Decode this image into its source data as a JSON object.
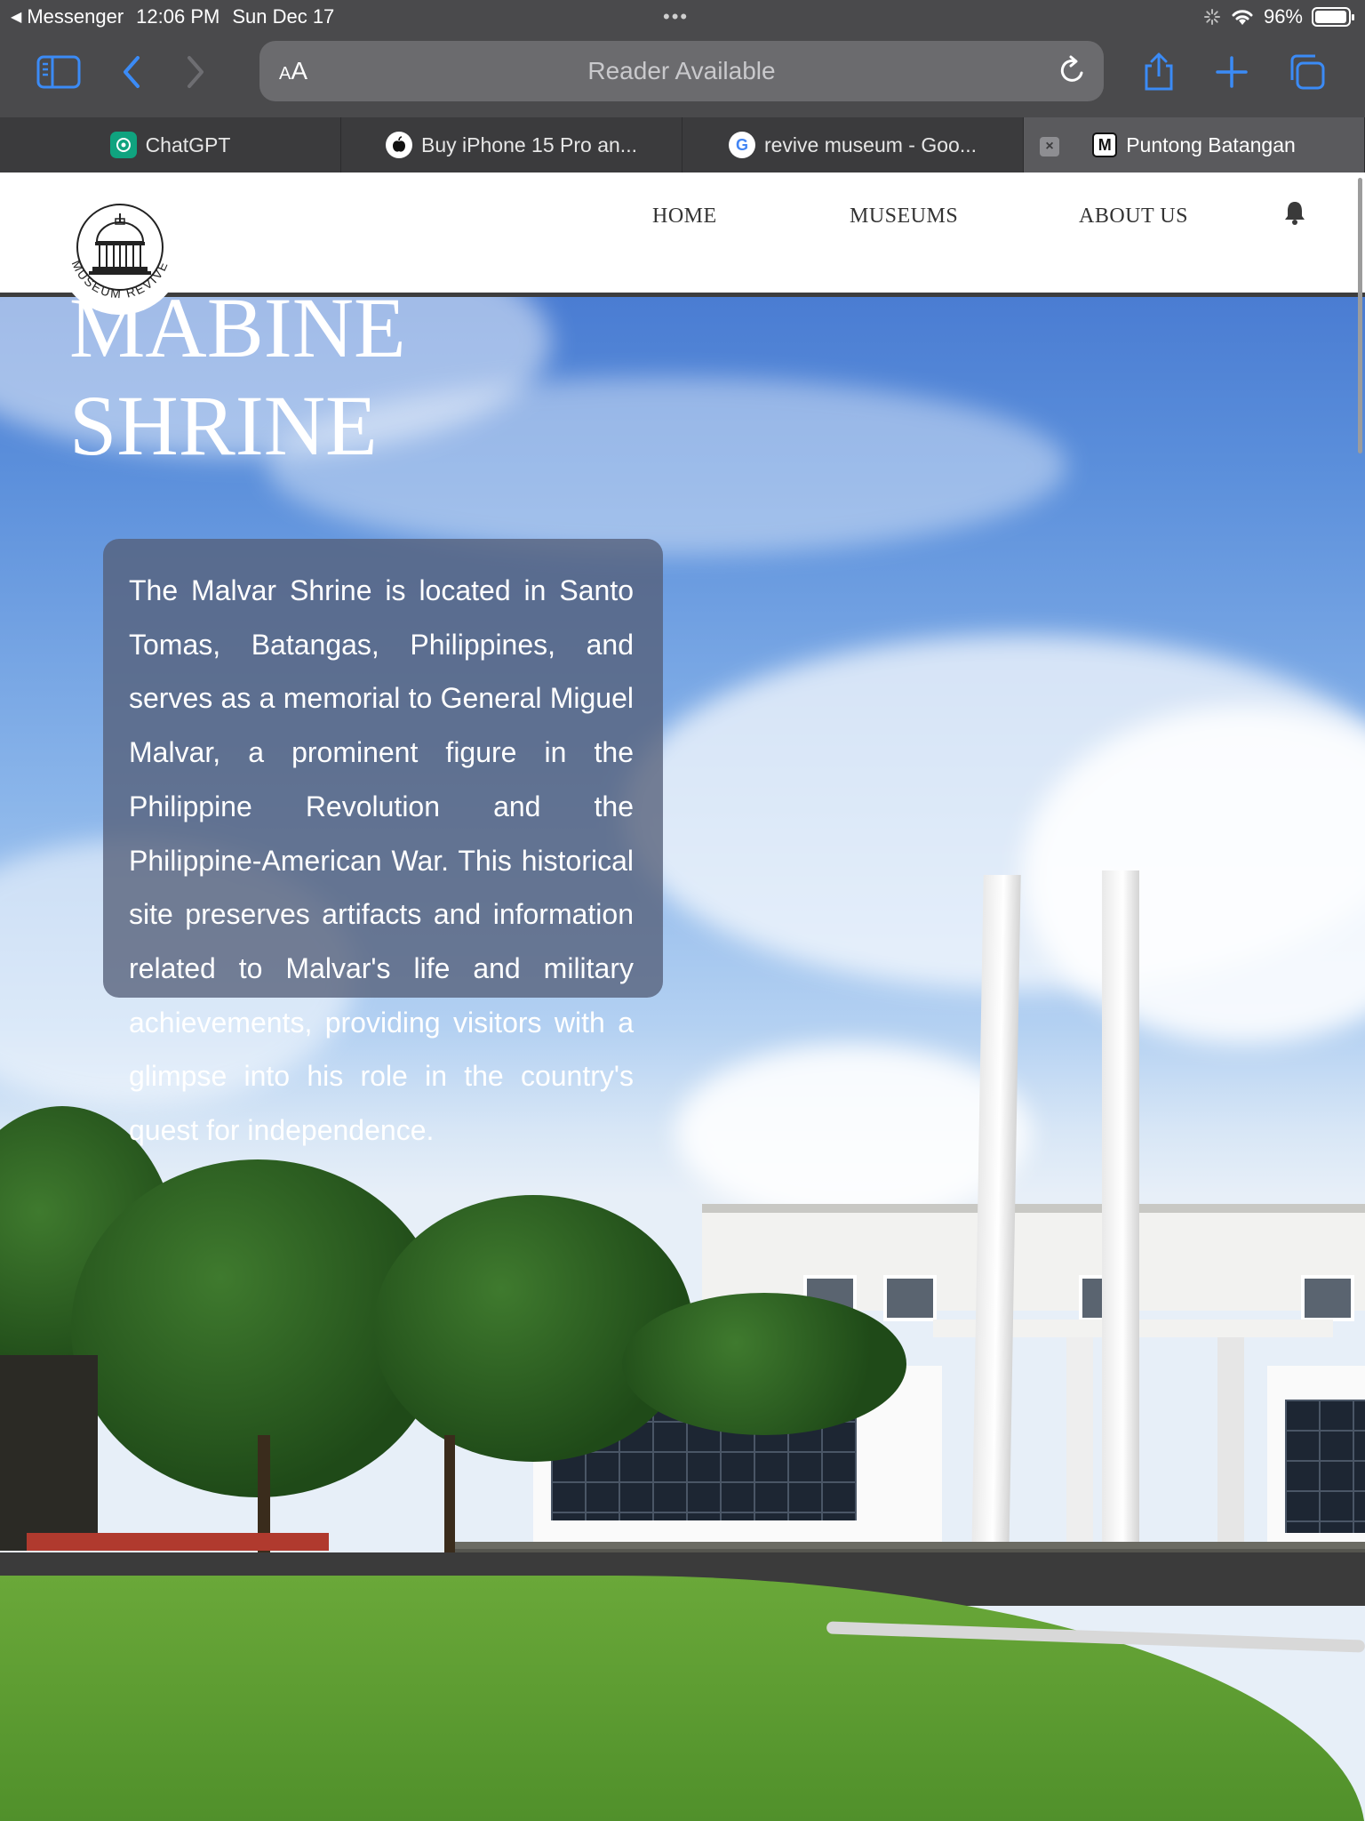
{
  "status_bar": {
    "back_app": "Messenger",
    "time": "12:06 PM",
    "date": "Sun Dec 17",
    "battery": "96%",
    "battery_level": 0.96
  },
  "toolbar": {
    "text_size_label_small": "A",
    "text_size_label_large": "A",
    "address_text": "Reader Available"
  },
  "tabs": [
    {
      "label": "ChatGPT",
      "icon": "chatgpt-icon",
      "color": "#10a37f",
      "active": false
    },
    {
      "label": "Buy iPhone 15 Pro an...",
      "icon": "apple-icon",
      "color": "#ffffff",
      "active": false
    },
    {
      "label": "revive museum - Goo...",
      "icon": "google-icon",
      "color": "#ffffff",
      "active": false
    },
    {
      "label": "Puntong Batangan",
      "icon": "m-icon",
      "favicon_letter": "M",
      "color": "#ffffff",
      "active": true
    }
  ],
  "site": {
    "logo_text": "MUSEUM REVIVE",
    "nav": {
      "home": "HOME",
      "museums": "MUSEUMS",
      "about": "ABOUT US"
    },
    "hero": {
      "title_line1": "MABINE",
      "title_line2": "SHRINE",
      "description": "The Malvar Shrine is located in Santo Tomas, Batangas, Philippines, and serves as a memorial to General Miguel Malvar, a prominent figure in the Philippine Revolution and the Philippine-American War. This historical site preserves artifacts and information related to Malvar's life and military achievements, providing visitors with a glimpse into his role in the country's quest for independence."
    }
  },
  "colors": {
    "browser_chrome": "#4a4a4c",
    "accent_blue": "#3b8bf6",
    "nav_bar": "#ffffff",
    "overlay_box": "#555f78"
  }
}
